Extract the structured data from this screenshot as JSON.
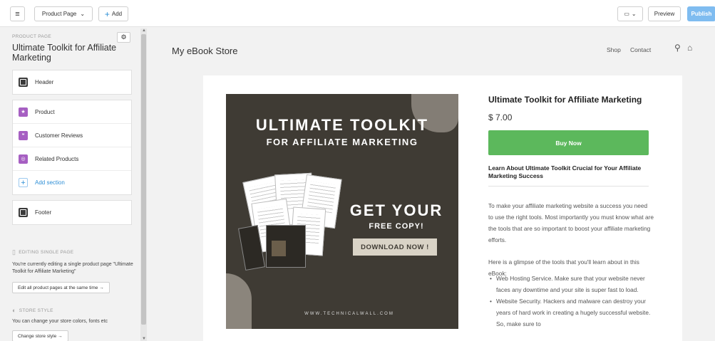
{
  "topbar": {
    "menu_icon": "hamburger-icon",
    "page_select": "Product Page",
    "add_label": "Add",
    "device_icon": "desktop-icon",
    "preview_label": "Preview",
    "publish_label": "Publish"
  },
  "sidebar": {
    "eyebrow": "PRODUCT PAGE",
    "title": "Ultimate Toolkit for Affiliate Marketing",
    "header_section": "Header",
    "sections": [
      {
        "label": "Product",
        "icon": "star-icon"
      },
      {
        "label": "Customer Reviews",
        "icon": "reviews-icon"
      },
      {
        "label": "Related Products",
        "icon": "related-products-icon"
      }
    ],
    "add_section": "Add section",
    "footer_section": "Footer",
    "editing_head": "EDITING SINGLE PAGE",
    "editing_note": "You're currently editing a single product page \"Ultimate Toolkit for Affiliate Marketing\"",
    "edit_all_button": "Edit all product pages at the same time →",
    "style_head": "STORE STYLE",
    "style_note": "You can change your store colors, fonts etc",
    "change_style_button": "Change store style →"
  },
  "store": {
    "name": "My eBook Store",
    "nav": [
      "Shop",
      "Contact"
    ]
  },
  "product": {
    "cover": {
      "title": "ULTIMATE TOOLKIT",
      "subtitle": "FOR AFFILIATE MARKETING",
      "get": "GET YOUR",
      "free": "FREE COPY!",
      "download": "DOWNLOAD NOW !",
      "url": "WWW.TECHNICALWALL.COM"
    },
    "title": "Ultimate Toolkit for Affiliate Marketing",
    "price": "$ 7.00",
    "buy_label": "Buy Now",
    "desc_heading": "Learn About Ultimate Toolkit Crucial for Your Affiliate Marketing Success",
    "desc_p1": "To make your affiliate marketing website a success you need to use the right tools. Most importantly you must know what are the tools that are so important to boost your affiliate marketing efforts.",
    "desc_p2": "Here is a glimpse of the tools that you'll learn about in this eBook:",
    "list": [
      "Web Hosting Service. Make sure that your website never faces any downtime and your site is super fast to load.",
      "Website Security. Hackers and malware can destroy your years of hard work in creating a hugely successful website. So, make sure to"
    ]
  },
  "colors": {
    "accent": "#2f8fd6",
    "publish": "#7fbcf0",
    "buy": "#5cb85c",
    "cover_bg": "#3f3b34",
    "section_icon": "#a65fc2"
  }
}
